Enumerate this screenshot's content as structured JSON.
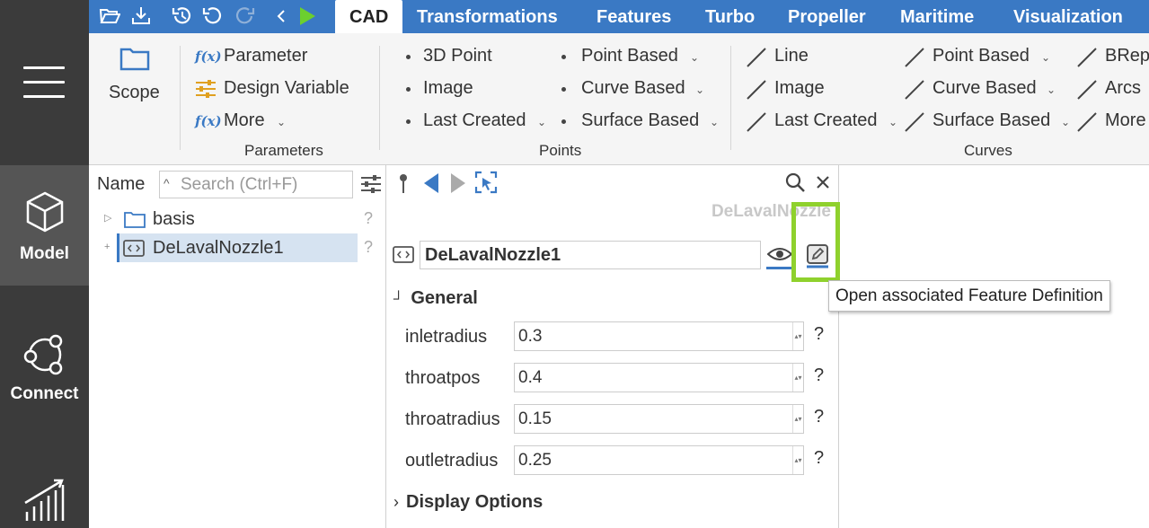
{
  "nav": {
    "model_label": "Model",
    "connect_label": "Connect"
  },
  "tabs": [
    "CAD",
    "Transformations",
    "Features",
    "Turbo",
    "Propeller",
    "Maritime",
    "Visualization"
  ],
  "ribbon": {
    "scope_label": "Scope",
    "parameters": {
      "title": "Parameters",
      "parameter": "Parameter",
      "design_variable": "Design Variable",
      "more": "More",
      "fx": "f(x)"
    },
    "points": {
      "title": "Points",
      "point_3d": "3D Point",
      "image": "Image",
      "last_created": "Last Created",
      "point_based": "Point Based",
      "curve_based": "Curve Based",
      "surface_based": "Surface Based"
    },
    "curves": {
      "title": "Curves",
      "line": "Line",
      "image": "Image",
      "last_created": "Last Created",
      "point_based": "Point Based",
      "curve_based": "Curve Based",
      "surface_based": "Surface Based",
      "brep": "BRep",
      "arcs": "Arcs",
      "more": "More"
    }
  },
  "tree": {
    "header": "Name",
    "search_placeholder": "Search (Ctrl+F)",
    "items": [
      {
        "label": "basis",
        "q": "?"
      },
      {
        "label": "DeLavalNozzle1",
        "q": "?"
      }
    ]
  },
  "props": {
    "workspace_title": "DeLavalNozzle",
    "name_value": "DeLavalNozzle1",
    "general_label": "General",
    "display_options_label": "Display Options",
    "rows": [
      {
        "label": "inletradius",
        "value": "0.3",
        "q": "?"
      },
      {
        "label": "throatpos",
        "value": "0.4",
        "q": "?"
      },
      {
        "label": "throatradius",
        "value": "0.15",
        "q": "?"
      },
      {
        "label": "outletradius",
        "value": "0.25",
        "q": "?"
      }
    ]
  },
  "tooltip": "Open associated Feature Definition",
  "colors": {
    "accent": "#3a79c4",
    "highlight": "#8fd12d",
    "sidebar": "#3b3b3b"
  }
}
